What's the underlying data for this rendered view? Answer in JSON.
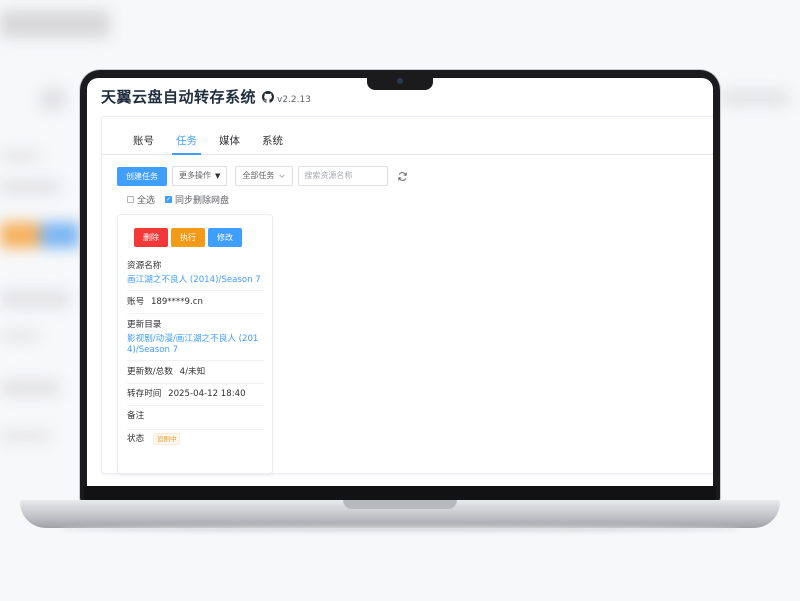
{
  "app": {
    "title": "天翼云盘自动转存系统",
    "version": "v2.2.13"
  },
  "tabs": [
    {
      "label": "账号",
      "active": false
    },
    {
      "label": "任务",
      "active": true
    },
    {
      "label": "媒体",
      "active": false
    },
    {
      "label": "系统",
      "active": false
    }
  ],
  "toolbar": {
    "create_label": "创建任务",
    "more_label": "更多操作",
    "filter_value": "全部任务",
    "search_placeholder": "搜索资源名称"
  },
  "checks": {
    "select_all": "全选",
    "sync_delete": "同步删除网盘",
    "sync_delete_checked": true
  },
  "task": {
    "delete_label": "删除",
    "execute_label": "执行",
    "edit_label": "修改",
    "resource_label": "资源名称",
    "resource_value": "画江湖之不良人 (2014)/Season 7",
    "account_label": "账号",
    "account_value": "189****9.cn",
    "dir_label": "更新目录",
    "dir_value_line1": "影视剧/动漫/画江湖之不良人 (201",
    "dir_value_line2": "4)/Season 7",
    "count_label": "更新数/总数",
    "count_value": "4/未知",
    "time_label": "转存时间",
    "time_value": "2025-04-12 18:40",
    "note_label": "备注",
    "status_label": "状态",
    "status_value": "追剧中"
  },
  "colors": {
    "primary": "#409eff",
    "danger": "#f23838",
    "warning": "#f39a17"
  }
}
